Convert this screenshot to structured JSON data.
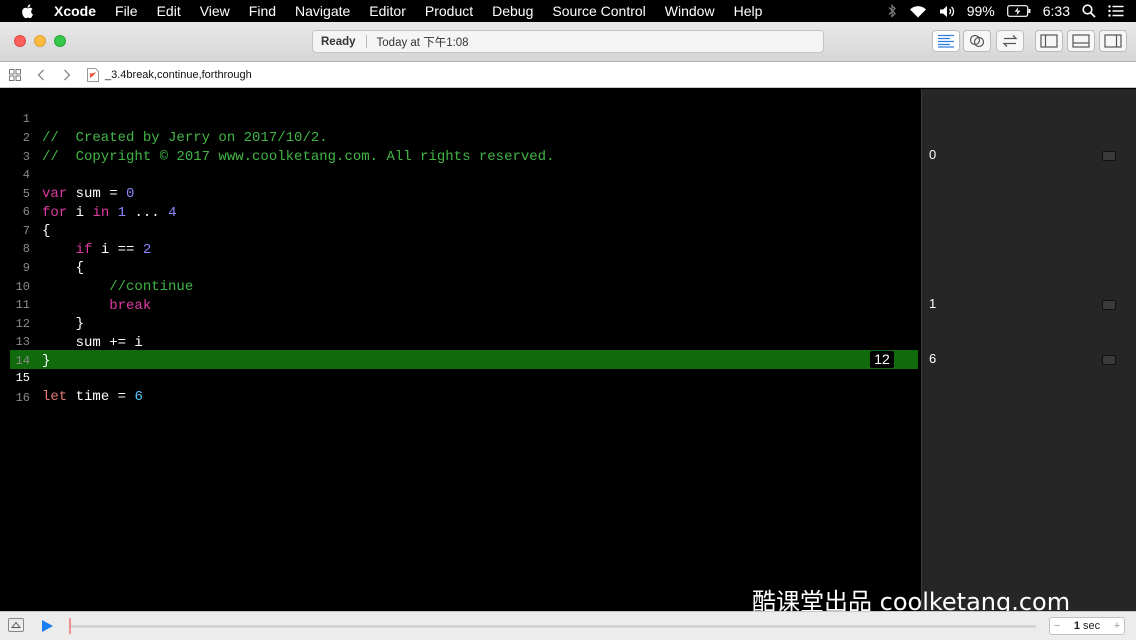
{
  "menubar": {
    "app_name": "Xcode",
    "items": [
      "File",
      "Edit",
      "View",
      "Find",
      "Navigate",
      "Editor",
      "Product",
      "Debug",
      "Source Control",
      "Window",
      "Help"
    ],
    "battery": "99%",
    "time": "6:33"
  },
  "toolbar": {
    "status": "Ready",
    "timestamp": "Today at 下午1:08"
  },
  "jumpbar": {
    "file_name": "_3.4break,continue,forthrough"
  },
  "editor": {
    "lines": [
      {
        "n": "1",
        "type": "comment",
        "text": "//  Created by Jerry on 2017/10/2."
      },
      {
        "n": "2",
        "type": "comment",
        "text": "//  Copyright © 2017 www.coolketang.com. All rights reserved."
      },
      {
        "n": "3",
        "type": "blank",
        "text": ""
      },
      {
        "n": "4",
        "type": "code",
        "text": "var sum = 0"
      },
      {
        "n": "5",
        "type": "code",
        "text": "for i in 1 ... 4"
      },
      {
        "n": "6",
        "type": "code",
        "text": "{"
      },
      {
        "n": "7",
        "type": "code",
        "text": "    if i == 2"
      },
      {
        "n": "8",
        "type": "code",
        "text": "    {"
      },
      {
        "n": "9",
        "type": "code",
        "text": "        //continue"
      },
      {
        "n": "10",
        "type": "code",
        "text": "        break"
      },
      {
        "n": "11",
        "type": "code",
        "text": "    }"
      },
      {
        "n": "12",
        "type": "code",
        "text": "    sum += i"
      },
      {
        "n": "13",
        "type": "code",
        "text": "}"
      },
      {
        "n": "14",
        "type": "blank",
        "text": ""
      },
      {
        "n": "15",
        "type": "code",
        "text": "let time = 6"
      },
      {
        "n": "16",
        "type": "blank",
        "text": ""
      }
    ],
    "inline_result": "12"
  },
  "results": {
    "line4": "0",
    "line12": "1",
    "line15": "6"
  },
  "debug": {
    "step_value": "1",
    "step_unit": "sec",
    "minus": "−",
    "plus": "+"
  },
  "watermark": "酷课堂出品 coolketang.com"
}
